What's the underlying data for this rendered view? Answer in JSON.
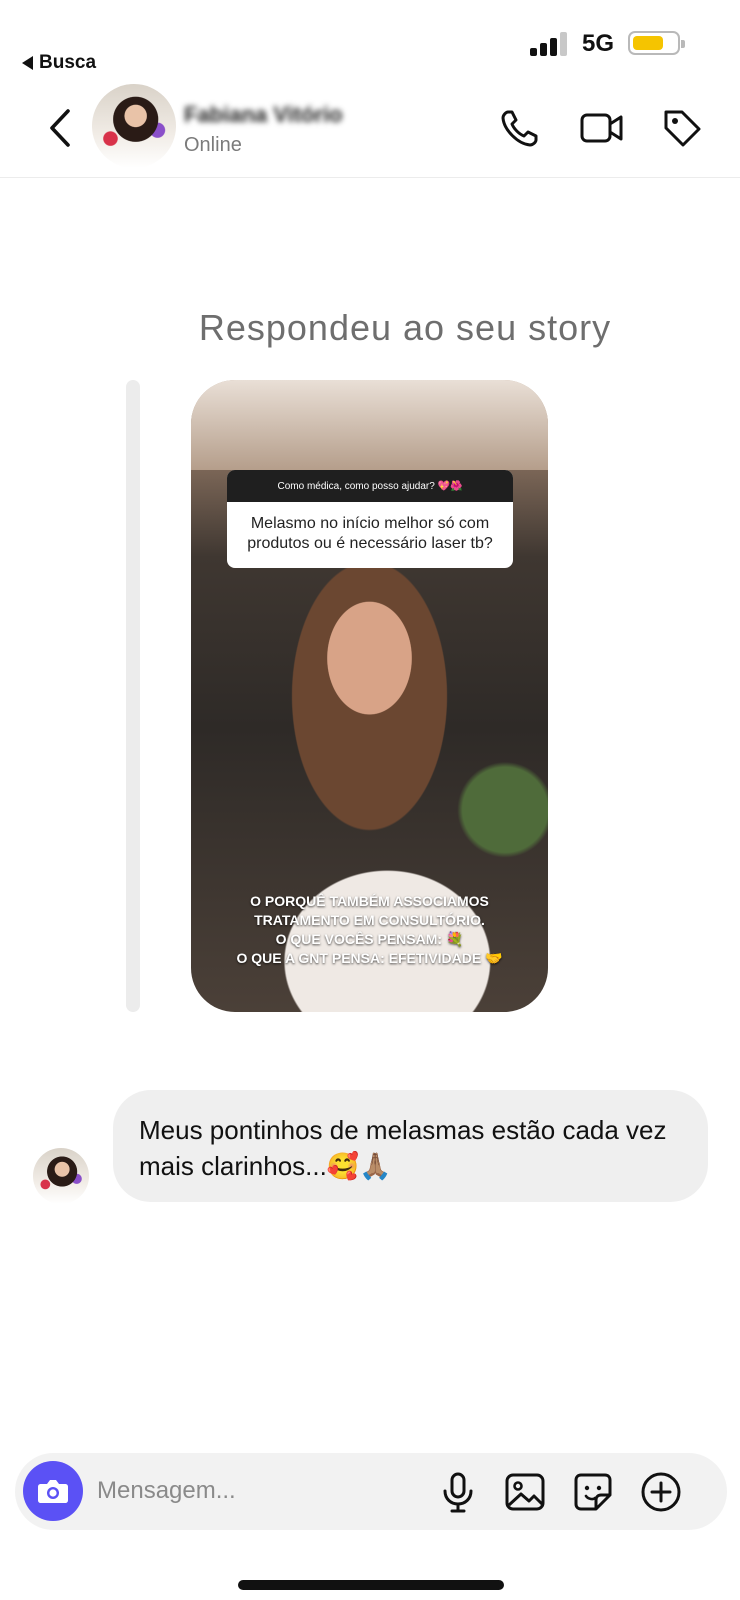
{
  "status_bar": {
    "back_app_label": "Busca",
    "network": "5G",
    "battery_level": 0.72
  },
  "header": {
    "contact_name": "Fabiana Vitório",
    "contact_status": "Online",
    "icons": [
      "chevron-left-icon",
      "phone-icon",
      "video-camera-icon",
      "tag-icon"
    ]
  },
  "conversation": {
    "reply_label": "Respondeu ao seu story",
    "story": {
      "question_header": "Como médica, como posso ajudar? 💖🌺",
      "question_text": "Melasmo no início melhor só com produtos ou é necessário laser tb?",
      "caption_lines": [
        "O PORQUÊ TAMBÉM ASSOCIAMOS",
        "TRATAMENTO EM CONSULTÓRIO.",
        "O QUE VOCÊS PENSAM: 💐",
        "O QUE A GNT PENSA: EFETIVIDADE 🤝"
      ]
    },
    "message": {
      "text": "Meus pontinhos de melasmas estão cada vez mais clarinhos...🥰🙏🏽"
    }
  },
  "composer": {
    "placeholder": "Mensagem...",
    "icons": [
      "camera-icon",
      "microphone-icon",
      "image-icon",
      "sticker-icon",
      "plus-circle-icon"
    ],
    "accent_color": "#5b51f5"
  }
}
